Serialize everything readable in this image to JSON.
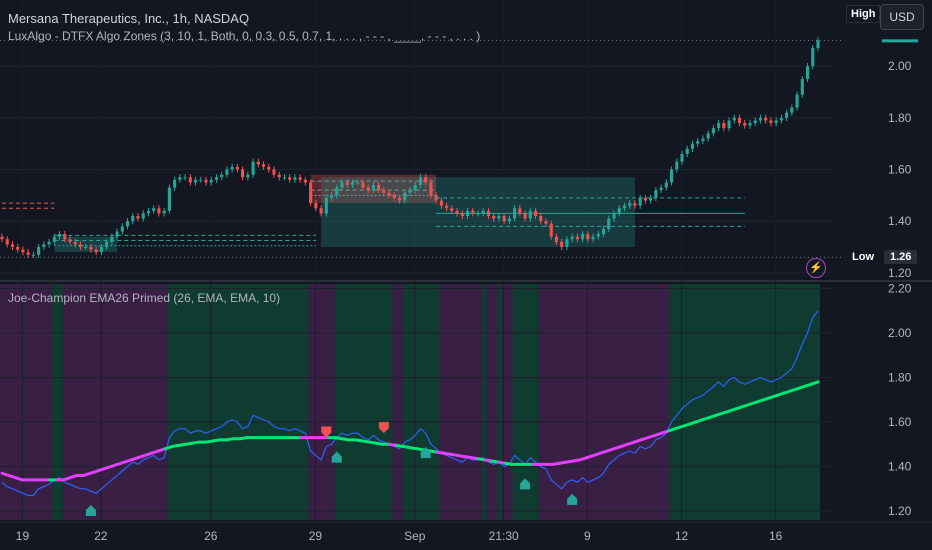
{
  "header": {
    "symbol_title": "Mersana Therapeutics, Inc., 1h, NASDAQ",
    "indicator_label": "LuxAlgo - DTFX Algo Zones (3, 10, 1, Both, 0, 0.3, 0.5, 0.7, 1, . . . , - - - , ____, - - - , . . . )",
    "currency_button": "USD",
    "high_label": "High",
    "low_label": "Low",
    "low_value": "1.26"
  },
  "colors": {
    "background": "#131722",
    "up_candle": "#26a69a",
    "down_candle": "#ef5350",
    "ema_bull": "#00e676",
    "ema_bear": "#e040fb",
    "price_line": "#2962ff",
    "zone_bull": "#26a69a",
    "zone_bear": "#ef5350",
    "band_bull": "#0f3b30",
    "band_bear": "#3a1f45"
  },
  "chart_data": [
    {
      "type": "candlestick",
      "title": "Mersana Therapeutics, Inc., 1h, NASDAQ",
      "y_ticks": [
        2.0,
        1.8,
        1.6,
        1.4,
        1.2
      ],
      "ylim": [
        1.18,
        2.14
      ],
      "high_marker": 2.1,
      "low_marker": 1.26,
      "close": [
        1.33,
        1.31,
        1.3,
        1.29,
        1.28,
        1.27,
        1.27,
        1.3,
        1.31,
        1.32,
        1.34,
        1.35,
        1.33,
        1.32,
        1.31,
        1.3,
        1.3,
        1.29,
        1.28,
        1.3,
        1.32,
        1.34,
        1.36,
        1.38,
        1.4,
        1.42,
        1.41,
        1.43,
        1.44,
        1.45,
        1.43,
        1.44,
        1.53,
        1.56,
        1.57,
        1.57,
        1.55,
        1.56,
        1.56,
        1.55,
        1.56,
        1.57,
        1.58,
        1.6,
        1.61,
        1.6,
        1.57,
        1.58,
        1.63,
        1.62,
        1.61,
        1.6,
        1.58,
        1.57,
        1.57,
        1.56,
        1.57,
        1.56,
        1.55,
        1.47,
        1.45,
        1.43,
        1.49,
        1.5,
        1.53,
        1.55,
        1.54,
        1.55,
        1.55,
        1.53,
        1.52,
        1.54,
        1.52,
        1.51,
        1.5,
        1.49,
        1.48,
        1.51,
        1.52,
        1.54,
        1.57,
        1.55,
        1.5,
        1.48,
        1.46,
        1.45,
        1.44,
        1.43,
        1.42,
        1.44,
        1.43,
        1.43,
        1.44,
        1.42,
        1.41,
        1.42,
        1.4,
        1.41,
        1.45,
        1.43,
        1.41,
        1.44,
        1.42,
        1.4,
        1.39,
        1.34,
        1.32,
        1.3,
        1.33,
        1.34,
        1.33,
        1.35,
        1.33,
        1.34,
        1.35,
        1.37,
        1.41,
        1.43,
        1.45,
        1.46,
        1.47,
        1.46,
        1.49,
        1.48,
        1.49,
        1.52,
        1.53,
        1.55,
        1.6,
        1.63,
        1.66,
        1.68,
        1.7,
        1.71,
        1.72,
        1.74,
        1.76,
        1.78,
        1.76,
        1.79,
        1.8,
        1.78,
        1.77,
        1.78,
        1.79,
        1.8,
        1.79,
        1.78,
        1.79,
        1.8,
        1.82,
        1.84,
        1.89,
        1.95,
        2.0,
        2.07,
        2.1
      ]
    },
    {
      "type": "line",
      "title": "Joe-Champion EMA26 Primed (26, EMA, EMA, 10)",
      "y_ticks": [
        2.2,
        2.0,
        1.8,
        1.6,
        1.4,
        1.2
      ],
      "ylim": [
        1.16,
        2.22
      ],
      "x_tick_labels": [
        "19",
        "22",
        "26",
        "29",
        "Sep",
        "21:30",
        "9",
        "12",
        "16"
      ],
      "series": [
        {
          "role": "price",
          "values": [
            1.33,
            1.31,
            1.3,
            1.29,
            1.28,
            1.27,
            1.27,
            1.3,
            1.31,
            1.32,
            1.34,
            1.35,
            1.33,
            1.32,
            1.31,
            1.3,
            1.3,
            1.29,
            1.28,
            1.3,
            1.32,
            1.34,
            1.36,
            1.38,
            1.4,
            1.42,
            1.41,
            1.43,
            1.44,
            1.45,
            1.43,
            1.44,
            1.53,
            1.56,
            1.57,
            1.57,
            1.55,
            1.56,
            1.56,
            1.55,
            1.56,
            1.57,
            1.58,
            1.6,
            1.61,
            1.6,
            1.57,
            1.58,
            1.63,
            1.62,
            1.61,
            1.6,
            1.58,
            1.57,
            1.57,
            1.56,
            1.57,
            1.56,
            1.55,
            1.47,
            1.45,
            1.43,
            1.49,
            1.5,
            1.53,
            1.55,
            1.54,
            1.55,
            1.55,
            1.53,
            1.52,
            1.54,
            1.52,
            1.51,
            1.5,
            1.49,
            1.48,
            1.51,
            1.52,
            1.54,
            1.57,
            1.55,
            1.5,
            1.48,
            1.46,
            1.45,
            1.44,
            1.43,
            1.42,
            1.44,
            1.43,
            1.43,
            1.44,
            1.42,
            1.41,
            1.42,
            1.4,
            1.41,
            1.45,
            1.43,
            1.41,
            1.44,
            1.42,
            1.4,
            1.39,
            1.34,
            1.32,
            1.3,
            1.33,
            1.34,
            1.33,
            1.35,
            1.33,
            1.34,
            1.35,
            1.37,
            1.41,
            1.43,
            1.45,
            1.46,
            1.47,
            1.46,
            1.49,
            1.48,
            1.49,
            1.52,
            1.53,
            1.55,
            1.6,
            1.63,
            1.66,
            1.68,
            1.7,
            1.71,
            1.72,
            1.74,
            1.76,
            1.78,
            1.76,
            1.79,
            1.8,
            1.78,
            1.77,
            1.78,
            1.79,
            1.8,
            1.79,
            1.78,
            1.79,
            1.8,
            1.82,
            1.84,
            1.89,
            1.95,
            2.0,
            2.07,
            2.1
          ]
        },
        {
          "role": "ema",
          "values": [
            1.37,
            1.36,
            1.35,
            1.34,
            1.34,
            1.34,
            1.34,
            1.34,
            1.34,
            1.34,
            1.35,
            1.36,
            1.36,
            1.37,
            1.38,
            1.39,
            1.4,
            1.41,
            1.42,
            1.43,
            1.44,
            1.45,
            1.46,
            1.47,
            1.48,
            1.49,
            1.495,
            1.5,
            1.505,
            1.51,
            1.51,
            1.515,
            1.52,
            1.52,
            1.525,
            1.525,
            1.53,
            1.53,
            1.53,
            1.53,
            1.53,
            1.53,
            1.53,
            1.53,
            1.53,
            1.53,
            1.53,
            1.53,
            1.53,
            1.53,
            1.525,
            1.52,
            1.52,
            1.515,
            1.51,
            1.505,
            1.5,
            1.5,
            1.495,
            1.49,
            1.485,
            1.48,
            1.475,
            1.47,
            1.465,
            1.46,
            1.455,
            1.45,
            1.445,
            1.44,
            1.435,
            1.43,
            1.425,
            1.42,
            1.415,
            1.41,
            1.41,
            1.41,
            1.41,
            1.41,
            1.41,
            1.41,
            1.415,
            1.42,
            1.425,
            1.43,
            1.44,
            1.45,
            1.46,
            1.47,
            1.48,
            1.49,
            1.5,
            1.51,
            1.52,
            1.53,
            1.54,
            1.55,
            1.56,
            1.57,
            1.58,
            1.59,
            1.6,
            1.61,
            1.62,
            1.63,
            1.64,
            1.65,
            1.66,
            1.67,
            1.68,
            1.69,
            1.7,
            1.71,
            1.72,
            1.73,
            1.74,
            1.75,
            1.76,
            1.77,
            1.78
          ]
        }
      ]
    }
  ]
}
